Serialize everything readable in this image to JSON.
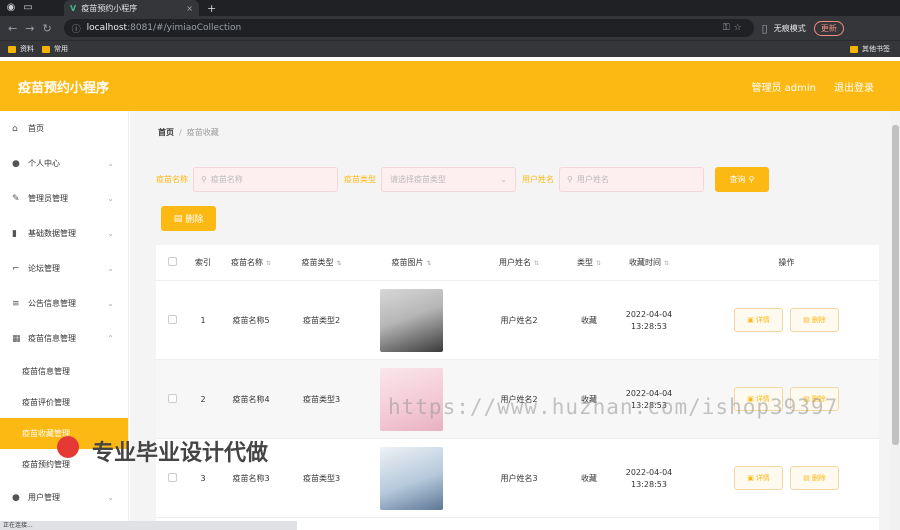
{
  "browser": {
    "tab_title": "疫苗预约小程序",
    "url_host": "localhost",
    "url_path": ":8081/#/yimiaoCollection",
    "incognito_label": "无痕模式",
    "update_label": "更新",
    "bookmarks": [
      "资料",
      "常用"
    ],
    "other_bookmarks": "其他书签"
  },
  "header": {
    "title": "疫苗预约小程序",
    "user": "管理员 admin",
    "logout": "退出登录"
  },
  "sidebar": {
    "items": [
      {
        "label": "首页",
        "icon": "home-icon"
      },
      {
        "label": "个人中心",
        "icon": "user-icon"
      },
      {
        "label": "管理员管理",
        "icon": "edit-icon"
      },
      {
        "label": "基础数据管理",
        "icon": "chart-icon"
      },
      {
        "label": "论坛管理",
        "icon": "crop-icon"
      },
      {
        "label": "公告信息管理",
        "icon": "list-icon"
      },
      {
        "label": "疫苗信息管理",
        "icon": "grid-icon"
      }
    ],
    "subitems": [
      "疫苗信息管理",
      "疫苗评价管理",
      "疫苗收藏管理",
      "疫苗预约管理"
    ],
    "bottom_item": "用户管理"
  },
  "breadcrumb": {
    "home": "首页",
    "current": "疫苗收藏"
  },
  "search": {
    "name_label": "疫苗名称",
    "name_placeholder": "疫苗名称",
    "type_label": "疫苗类型",
    "type_placeholder": "请选择疫苗类型",
    "user_label": "用户姓名",
    "user_placeholder": "用户姓名",
    "query_button": "查询"
  },
  "delete_button": "删除",
  "table": {
    "headers": [
      "索引",
      "疫苗名称",
      "疫苗类型",
      "疫苗图片",
      "用户姓名",
      "类型",
      "收藏时间",
      "操作"
    ],
    "rows": [
      {
        "index": "1",
        "name": "疫苗名称5",
        "type": "疫苗类型2",
        "user": "用户姓名2",
        "kind": "收藏",
        "date": "2022-04-04",
        "time": "13:28:53"
      },
      {
        "index": "2",
        "name": "疫苗名称4",
        "type": "疫苗类型3",
        "user": "用户姓名2",
        "kind": "收藏",
        "date": "2022-04-04",
        "time": "13:28:53"
      },
      {
        "index": "3",
        "name": "疫苗名称3",
        "type": "疫苗类型3",
        "user": "用户姓名3",
        "kind": "收藏",
        "date": "2022-04-04",
        "time": "13:28:53"
      }
    ],
    "detail_label": "详情",
    "delete_label": "删除"
  },
  "overlay": {
    "watermark": "https://www.huzhan.com/ishop39397",
    "promo": "专业毕业设计代做"
  },
  "status_text": "正在连接..."
}
